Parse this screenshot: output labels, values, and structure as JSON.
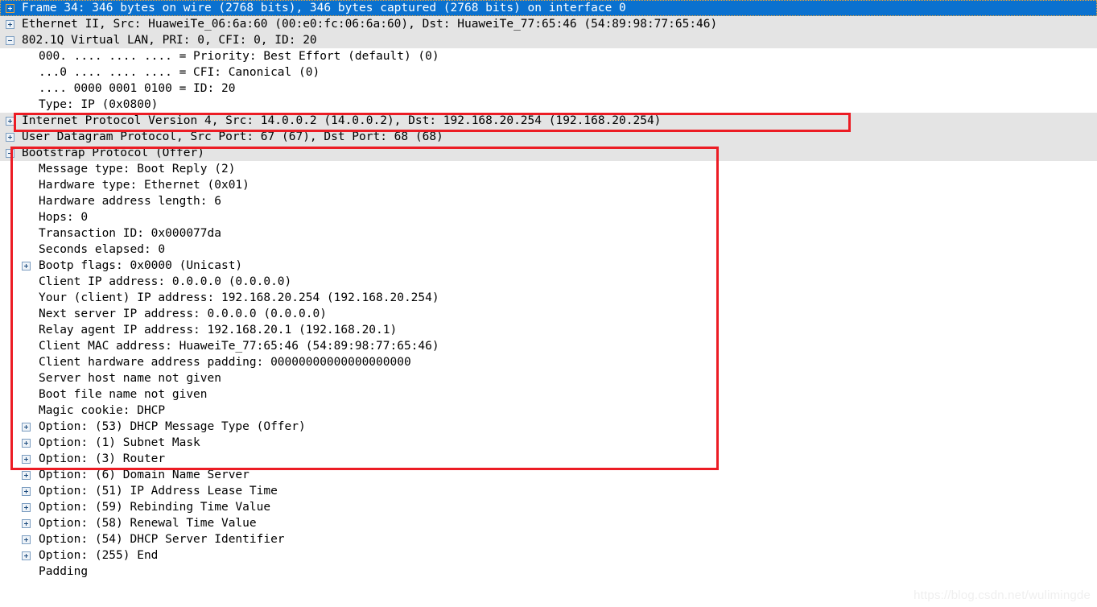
{
  "app": {
    "name": "Wireshark Packet Details",
    "selected_row_color": "#0a71cf",
    "shaded_row_color": "#e4e4e4",
    "annotation_color": "#ec1c24"
  },
  "watermark": {
    "text": "https://blog.csdn.net/wulimingde"
  },
  "annotations": [
    {
      "name": "ip-layer-highlight",
      "label": "red box around Internet Protocol Version 4 row"
    },
    {
      "name": "dhcp-layer-highlight",
      "label": "red box around Bootstrap Protocol (Offer) block"
    }
  ],
  "tree": {
    "rows": [
      {
        "text": "Frame 34: 346 bytes on wire (2768 bits), 346 bytes captured (2768 bits) on interface 0",
        "depth": 0,
        "expander": "plus",
        "state": "selected",
        "shaded": false,
        "name": "frame-row"
      },
      {
        "text": "Ethernet II, Src: HuaweiTe_06:6a:60 (00:e0:fc:06:6a:60), Dst: HuaweiTe_77:65:46 (54:89:98:77:65:46)",
        "depth": 0,
        "expander": "plus",
        "state": "normal",
        "shaded": true,
        "name": "ethernet-row"
      },
      {
        "text": "802.1Q Virtual LAN, PRI: 0, CFI: 0, ID: 20",
        "depth": 0,
        "expander": "minus",
        "state": "normal",
        "shaded": true,
        "name": "vlan-row"
      },
      {
        "text": "000. .... .... .... = Priority: Best Effort (default) (0)",
        "depth": 1,
        "expander": "none",
        "state": "normal",
        "shaded": false,
        "name": "vlan-priority-row"
      },
      {
        "text": "...0 .... .... .... = CFI: Canonical (0)",
        "depth": 1,
        "expander": "none",
        "state": "normal",
        "shaded": false,
        "name": "vlan-cfi-row"
      },
      {
        "text": ".... 0000 0001 0100 = ID: 20",
        "depth": 1,
        "expander": "none",
        "state": "normal",
        "shaded": false,
        "name": "vlan-id-row"
      },
      {
        "text": "Type: IP (0x0800)",
        "depth": 1,
        "expander": "none",
        "state": "normal",
        "shaded": false,
        "name": "vlan-type-row"
      },
      {
        "text": "Internet Protocol Version 4, Src: 14.0.0.2 (14.0.0.2), Dst: 192.168.20.254 (192.168.20.254)",
        "depth": 0,
        "expander": "plus",
        "state": "normal",
        "shaded": true,
        "name": "ipv4-row"
      },
      {
        "text": "User Datagram Protocol, Src Port: 67 (67), Dst Port: 68 (68)",
        "depth": 0,
        "expander": "plus",
        "state": "normal",
        "shaded": true,
        "name": "udp-row"
      },
      {
        "text": "Bootstrap Protocol (Offer)",
        "depth": 0,
        "expander": "minus",
        "state": "normal",
        "shaded": true,
        "name": "bootp-row"
      },
      {
        "text": "Message type: Boot Reply (2)",
        "depth": 1,
        "expander": "none",
        "state": "normal",
        "shaded": false,
        "name": "message-type-row"
      },
      {
        "text": "Hardware type: Ethernet (0x01)",
        "depth": 1,
        "expander": "none",
        "state": "normal",
        "shaded": false,
        "name": "hardware-type-row"
      },
      {
        "text": "Hardware address length: 6",
        "depth": 1,
        "expander": "none",
        "state": "normal",
        "shaded": false,
        "name": "hardware-address-length-row"
      },
      {
        "text": "Hops: 0",
        "depth": 1,
        "expander": "none",
        "state": "normal",
        "shaded": false,
        "name": "hops-row"
      },
      {
        "text": "Transaction ID: 0x000077da",
        "depth": 1,
        "expander": "none",
        "state": "normal",
        "shaded": false,
        "name": "transaction-id-row"
      },
      {
        "text": "Seconds elapsed: 0",
        "depth": 1,
        "expander": "none",
        "state": "normal",
        "shaded": false,
        "name": "seconds-elapsed-row"
      },
      {
        "text": "Bootp flags: 0x0000 (Unicast)",
        "depth": 1,
        "expander": "plus",
        "state": "normal",
        "shaded": false,
        "name": "bootp-flags-row"
      },
      {
        "text": "Client IP address: 0.0.0.0 (0.0.0.0)",
        "depth": 1,
        "expander": "none",
        "state": "normal",
        "shaded": false,
        "name": "client-ip-address-row"
      },
      {
        "text": "Your (client) IP address: 192.168.20.254 (192.168.20.254)",
        "depth": 1,
        "expander": "none",
        "state": "normal",
        "shaded": false,
        "name": "your-client-ip-address-row"
      },
      {
        "text": "Next server IP address: 0.0.0.0 (0.0.0.0)",
        "depth": 1,
        "expander": "none",
        "state": "normal",
        "shaded": false,
        "name": "next-server-ip-address-row"
      },
      {
        "text": "Relay agent IP address: 192.168.20.1 (192.168.20.1)",
        "depth": 1,
        "expander": "none",
        "state": "normal",
        "shaded": false,
        "name": "relay-agent-ip-address-row"
      },
      {
        "text": "Client MAC address: HuaweiTe_77:65:46 (54:89:98:77:65:46)",
        "depth": 1,
        "expander": "none",
        "state": "normal",
        "shaded": false,
        "name": "client-mac-address-row"
      },
      {
        "text": "Client hardware address padding: 00000000000000000000",
        "depth": 1,
        "expander": "none",
        "state": "normal",
        "shaded": false,
        "name": "client-hardware-address-padding-row"
      },
      {
        "text": "Server host name not given",
        "depth": 1,
        "expander": "none",
        "state": "normal",
        "shaded": false,
        "name": "server-host-name-row"
      },
      {
        "text": "Boot file name not given",
        "depth": 1,
        "expander": "none",
        "state": "normal",
        "shaded": false,
        "name": "boot-file-name-row"
      },
      {
        "text": "Magic cookie: DHCP",
        "depth": 1,
        "expander": "none",
        "state": "normal",
        "shaded": false,
        "name": "magic-cookie-row"
      },
      {
        "text": "Option: (53) DHCP Message Type (Offer)",
        "depth": 1,
        "expander": "plus",
        "state": "normal",
        "shaded": false,
        "name": "option-53-row"
      },
      {
        "text": "Option: (1) Subnet Mask",
        "depth": 1,
        "expander": "plus",
        "state": "normal",
        "shaded": false,
        "name": "option-1-row"
      },
      {
        "text": "Option: (3) Router",
        "depth": 1,
        "expander": "plus",
        "state": "normal",
        "shaded": false,
        "name": "option-3-row"
      },
      {
        "text": "Option: (6) Domain Name Server",
        "depth": 1,
        "expander": "plus",
        "state": "normal",
        "shaded": false,
        "name": "option-6-row"
      },
      {
        "text": "Option: (51) IP Address Lease Time",
        "depth": 1,
        "expander": "plus",
        "state": "normal",
        "shaded": false,
        "name": "option-51-row"
      },
      {
        "text": "Option: (59) Rebinding Time Value",
        "depth": 1,
        "expander": "plus",
        "state": "normal",
        "shaded": false,
        "name": "option-59-row"
      },
      {
        "text": "Option: (58) Renewal Time Value",
        "depth": 1,
        "expander": "plus",
        "state": "normal",
        "shaded": false,
        "name": "option-58-row"
      },
      {
        "text": "Option: (54) DHCP Server Identifier",
        "depth": 1,
        "expander": "plus",
        "state": "normal",
        "shaded": false,
        "name": "option-54-row"
      },
      {
        "text": "Option: (255) End",
        "depth": 1,
        "expander": "plus",
        "state": "normal",
        "shaded": false,
        "name": "option-255-row"
      },
      {
        "text": "Padding",
        "depth": 1,
        "expander": "none",
        "state": "normal",
        "shaded": false,
        "name": "padding-row"
      }
    ]
  }
}
